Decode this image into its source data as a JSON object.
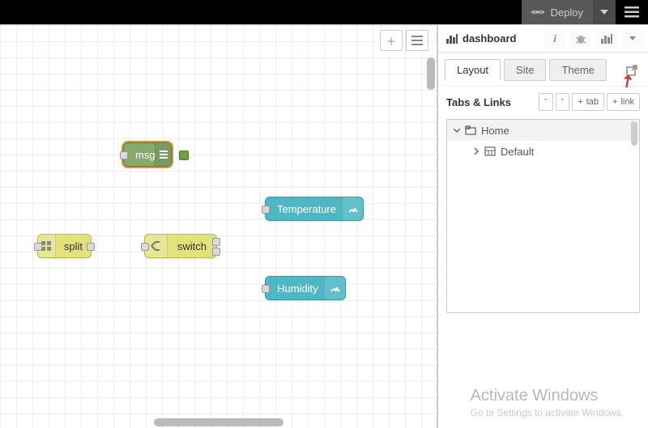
{
  "header": {
    "deploy_label": "Deploy"
  },
  "canvas_nodes": {
    "msg": "msg",
    "split": "split",
    "switch": "switch",
    "temperature": "Temperature",
    "humidity": "Humidity"
  },
  "sidebar": {
    "title": "dashboard",
    "tabs": {
      "layout": "Layout",
      "site": "Site",
      "theme": "Theme"
    },
    "section_title": "Tabs & Links",
    "buttons": {
      "tab": "tab",
      "link": "link"
    },
    "tree": {
      "home": "Home",
      "default": "Default"
    }
  },
  "watermark": {
    "line1": "Activate Windows",
    "line2": "Go to Settings to activate Windows."
  }
}
